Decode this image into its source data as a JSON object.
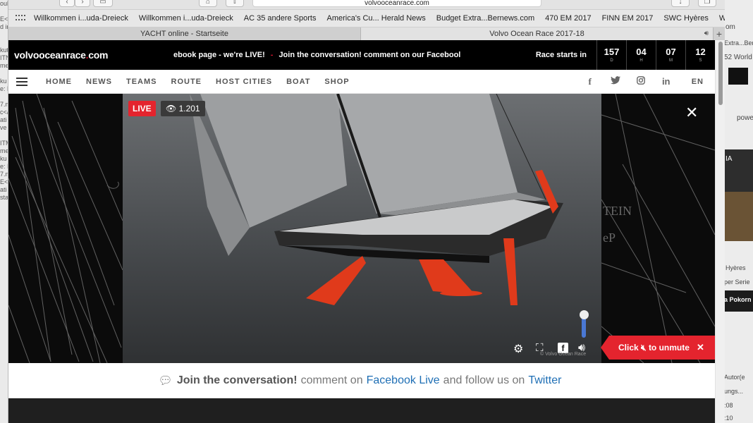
{
  "browser": {
    "url": "volvooceanrace.com",
    "bookmarks": [
      "Willkommen i...uda-Dreieck",
      "Willkommen i...uda-Dreieck",
      "AC 35 andere Sports",
      "America's Cu... Herald News",
      "Budget Extra...Bernews.com",
      "470 EM 2017",
      "FINN EM 2017",
      "SWC Hyères",
      "Wieser wins"
    ],
    "more": ">>",
    "tabs": [
      {
        "title": "YACHT online - Startseite"
      },
      {
        "title": "Volvo Ocean Race 2017-18"
      }
    ]
  },
  "site": {
    "logo_main": "volvooceanrace",
    "logo_dot": ".",
    "logo_tld": "com",
    "ticker_a": "ebook page - we're LIVE!",
    "ticker_sep": "-",
    "ticker_b": "Join the conversation! comment on our Facebool",
    "race_starts": "Race starts in",
    "countdown": [
      {
        "value": "157",
        "unit": "D"
      },
      {
        "value": "04",
        "unit": "H"
      },
      {
        "value": "07",
        "unit": "M"
      },
      {
        "value": "12",
        "unit": "S"
      }
    ],
    "nav": [
      "HOME",
      "NEWS",
      "TEAMS",
      "ROUTE",
      "HOST CITIES",
      "BOAT",
      "SHOP"
    ],
    "social": [
      "f",
      "t",
      "ig",
      "in"
    ],
    "lang": "EN"
  },
  "video": {
    "live": "LIVE",
    "viewers": "1.201",
    "copyright": "© Volvo Ocean Race",
    "unmute_pre": "Click",
    "unmute_post": "to unmute",
    "volume": 0.75
  },
  "join": {
    "bold": "Join the conversation!",
    "t1": "comment on",
    "link1": "Facebook Live",
    "t2": "and follow us on",
    "link2": "Twitter"
  },
  "background": {
    "left_snippets": [
      "oul",
      "E<",
      "d in",
      "kut",
      "ITN",
      "me",
      "ku",
      "e: P",
      "7.m",
      "c</",
      "ati",
      "ve",
      "ITM",
      "me",
      "ku",
      "e: P",
      "7.m",
      "E</",
      "ati",
      "sta"
    ],
    "right_snippets": [
      "om",
      "52 World",
      "powe",
      "Extra...Ber",
      "IA",
      "Hyères",
      "per Serie",
      "a Pokorn",
      "Autor(e",
      "ungs...",
      ":08",
      ":10"
    ]
  },
  "colors": {
    "brand_red": "#e4242e",
    "link_blue": "#1f6fb5"
  }
}
